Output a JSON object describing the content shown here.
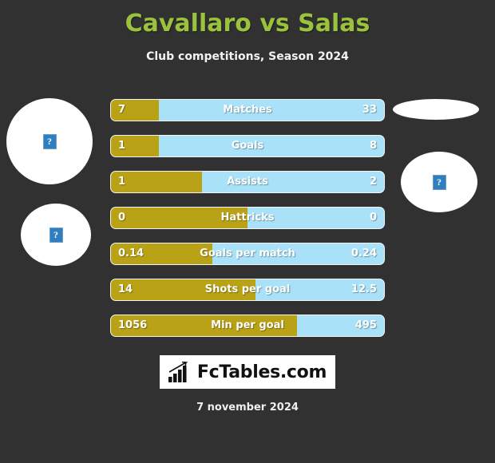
{
  "header": {
    "title": "Cavallaro vs Salas",
    "subtitle": "Club competitions, Season 2024",
    "title_color": "#9ac23c"
  },
  "avatars": {
    "placeholder_glyph": "?",
    "home_top_name": "home-player-photo",
    "home_bottom_name": "home-club-logo",
    "away_top_name": "away-club-logo",
    "away_bottom_name": "away-player-photo"
  },
  "colors": {
    "background": "#313131",
    "home_bar": "#b9a216",
    "away_bar": "#a9e2f8",
    "text": "#ffffff"
  },
  "logo": {
    "text": "FcTables.com",
    "icon": "bar-chart-icon"
  },
  "footer": {
    "date": "7 november 2024"
  },
  "chart_data": {
    "type": "bar",
    "title": "Cavallaro vs Salas",
    "subtitle": "Club competitions, Season 2024",
    "orientation": "horizontal-diverging",
    "series": [
      {
        "name": "Cavallaro",
        "color": "#b9a216",
        "values": [
          7,
          1,
          1,
          0,
          0.14,
          14,
          1056
        ]
      },
      {
        "name": "Salas",
        "color": "#a9e2f8",
        "values": [
          33,
          8,
          2,
          0,
          0.24,
          12.5,
          495
        ]
      }
    ],
    "categories": [
      "Matches",
      "Goals",
      "Assists",
      "Hattricks",
      "Goals per match",
      "Shots per goal",
      "Min per goal"
    ],
    "rows": [
      {
        "label": "Matches",
        "home": "7",
        "away": "33",
        "home_pct": 17.5
      },
      {
        "label": "Goals",
        "home": "1",
        "away": "8",
        "home_pct": 17.5
      },
      {
        "label": "Assists",
        "home": "1",
        "away": "2",
        "home_pct": 33.3
      },
      {
        "label": "Hattricks",
        "home": "0",
        "away": "0",
        "home_pct": 50.0
      },
      {
        "label": "Goals per match",
        "home": "0.14",
        "away": "0.24",
        "home_pct": 37.0
      },
      {
        "label": "Shots per goal",
        "home": "14",
        "away": "12.5",
        "home_pct": 53.0
      },
      {
        "label": "Min per goal",
        "home": "1056",
        "away": "495",
        "home_pct": 68.0
      }
    ],
    "legend": [
      "Cavallaro",
      "Salas"
    ],
    "grid": false
  }
}
